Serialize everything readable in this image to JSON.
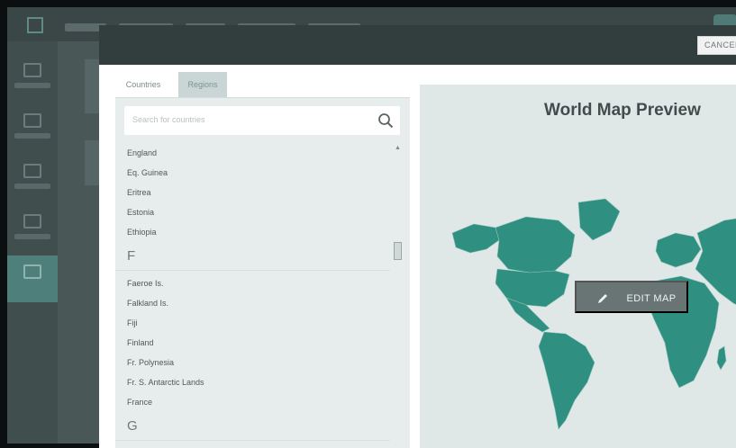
{
  "modal": {
    "cancel_label": "CANCEL",
    "tabs": [
      {
        "label": "Countries",
        "active": true
      },
      {
        "label": "Regions",
        "active": false
      }
    ],
    "search": {
      "placeholder": "Search for countries"
    },
    "list_e": [
      "England",
      "Eq. Guinea",
      "Eritrea",
      "Estonia",
      "Ethiopia"
    ],
    "letter_f": "F",
    "list_f": [
      "Faeroe Is.",
      "Falkland Is.",
      "Fiji",
      "Finland",
      "Fr. Polynesia",
      "Fr. S. Antarctic Lands",
      "France"
    ],
    "letter_g": "G",
    "preview": {
      "title": "World Map Preview",
      "edit_label": "EDIT MAP"
    }
  },
  "colors": {
    "map_fill": "#2f8f80",
    "map_background": "#dfe7e7",
    "modal_header": "#323d3d",
    "selected_tab": "#c9d6d5"
  },
  "icons": [
    "search-icon",
    "pencil-icon",
    "scroll-up-icon",
    "scrollbar-thumb"
  ]
}
